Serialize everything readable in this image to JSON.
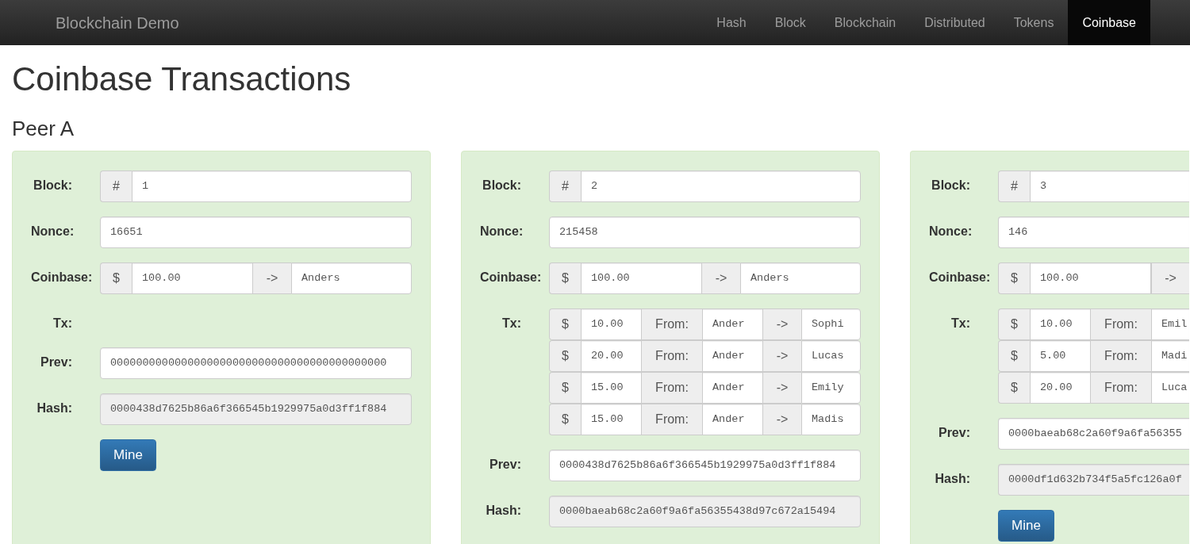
{
  "navbar": {
    "brand": "Blockchain Demo",
    "items": [
      {
        "label": "Hash",
        "selected": false
      },
      {
        "label": "Block",
        "selected": false
      },
      {
        "label": "Blockchain",
        "selected": false
      },
      {
        "label": "Distributed",
        "selected": false
      },
      {
        "label": "Tokens",
        "selected": false
      },
      {
        "label": "Coinbase",
        "selected": true
      }
    ]
  },
  "title": "Coinbase Transactions",
  "peer": "Peer A",
  "blocks": [
    {
      "block_label": "Block:",
      "hash_sign": "#",
      "number": "1",
      "nonce_label": "Nonce:",
      "nonce": "16651",
      "coinbase_label": "Coinbase:",
      "coinbase": {
        "currency": "$",
        "amount": "100.00",
        "arrow": "->",
        "to": "Anders"
      },
      "tx_label": "Tx:",
      "prev_label": "Prev:",
      "prev": "0000000000000000000000000000000000000000000",
      "hash_label": "Hash:",
      "hash": "0000438d7625b86a6f366545b1929975a0d3ff1f884",
      "mine_button": "Mine"
    },
    {
      "block_label": "Block:",
      "hash_sign": "#",
      "number": "2",
      "nonce_label": "Nonce:",
      "nonce": "215458",
      "coinbase_label": "Coinbase:",
      "coinbase": {
        "currency": "$",
        "amount": "100.00",
        "arrow": "->",
        "to": "Anders"
      },
      "tx_label": "Tx:",
      "transactions": [
        {
          "currency": "$",
          "amount": "10.00",
          "from_label": "From:",
          "from": "Ander",
          "arrow": "->",
          "to": "Sophi"
        },
        {
          "currency": "$",
          "amount": "20.00",
          "from_label": "From:",
          "from": "Ander",
          "arrow": "->",
          "to": "Lucas"
        },
        {
          "currency": "$",
          "amount": "15.00",
          "from_label": "From:",
          "from": "Ander",
          "arrow": "->",
          "to": "Emily"
        },
        {
          "currency": "$",
          "amount": "15.00",
          "from_label": "From:",
          "from": "Ander",
          "arrow": "->",
          "to": "Madis"
        }
      ],
      "prev_label": "Prev:",
      "prev": "0000438d7625b86a6f366545b1929975a0d3ff1f884",
      "hash_label": "Hash:",
      "hash": "0000baeab68c2a60f9a6fa56355438d97c672a15494"
    },
    {
      "block_label": "Block:",
      "hash_sign": "#",
      "number": "3",
      "nonce_label": "Nonce:",
      "nonce": "146",
      "coinbase_label": "Coinbase:",
      "coinbase": {
        "currency": "$",
        "amount": "100.00",
        "arrow": "->"
      },
      "tx_label": "Tx:",
      "transactions": [
        {
          "currency": "$",
          "amount": "10.00",
          "from_label": "From:",
          "from": "Emil"
        },
        {
          "currency": "$",
          "amount": "5.00",
          "from_label": "From:",
          "from": "Madi"
        },
        {
          "currency": "$",
          "amount": "20.00",
          "from_label": "From:",
          "from": "Luca"
        }
      ],
      "prev_label": "Prev:",
      "prev": "0000baeab68c2a60f9a6fa56355",
      "hash_label": "Hash:",
      "hash": "0000df1d632b734f5a5fc126a0f",
      "mine_button": "Mine"
    }
  ]
}
